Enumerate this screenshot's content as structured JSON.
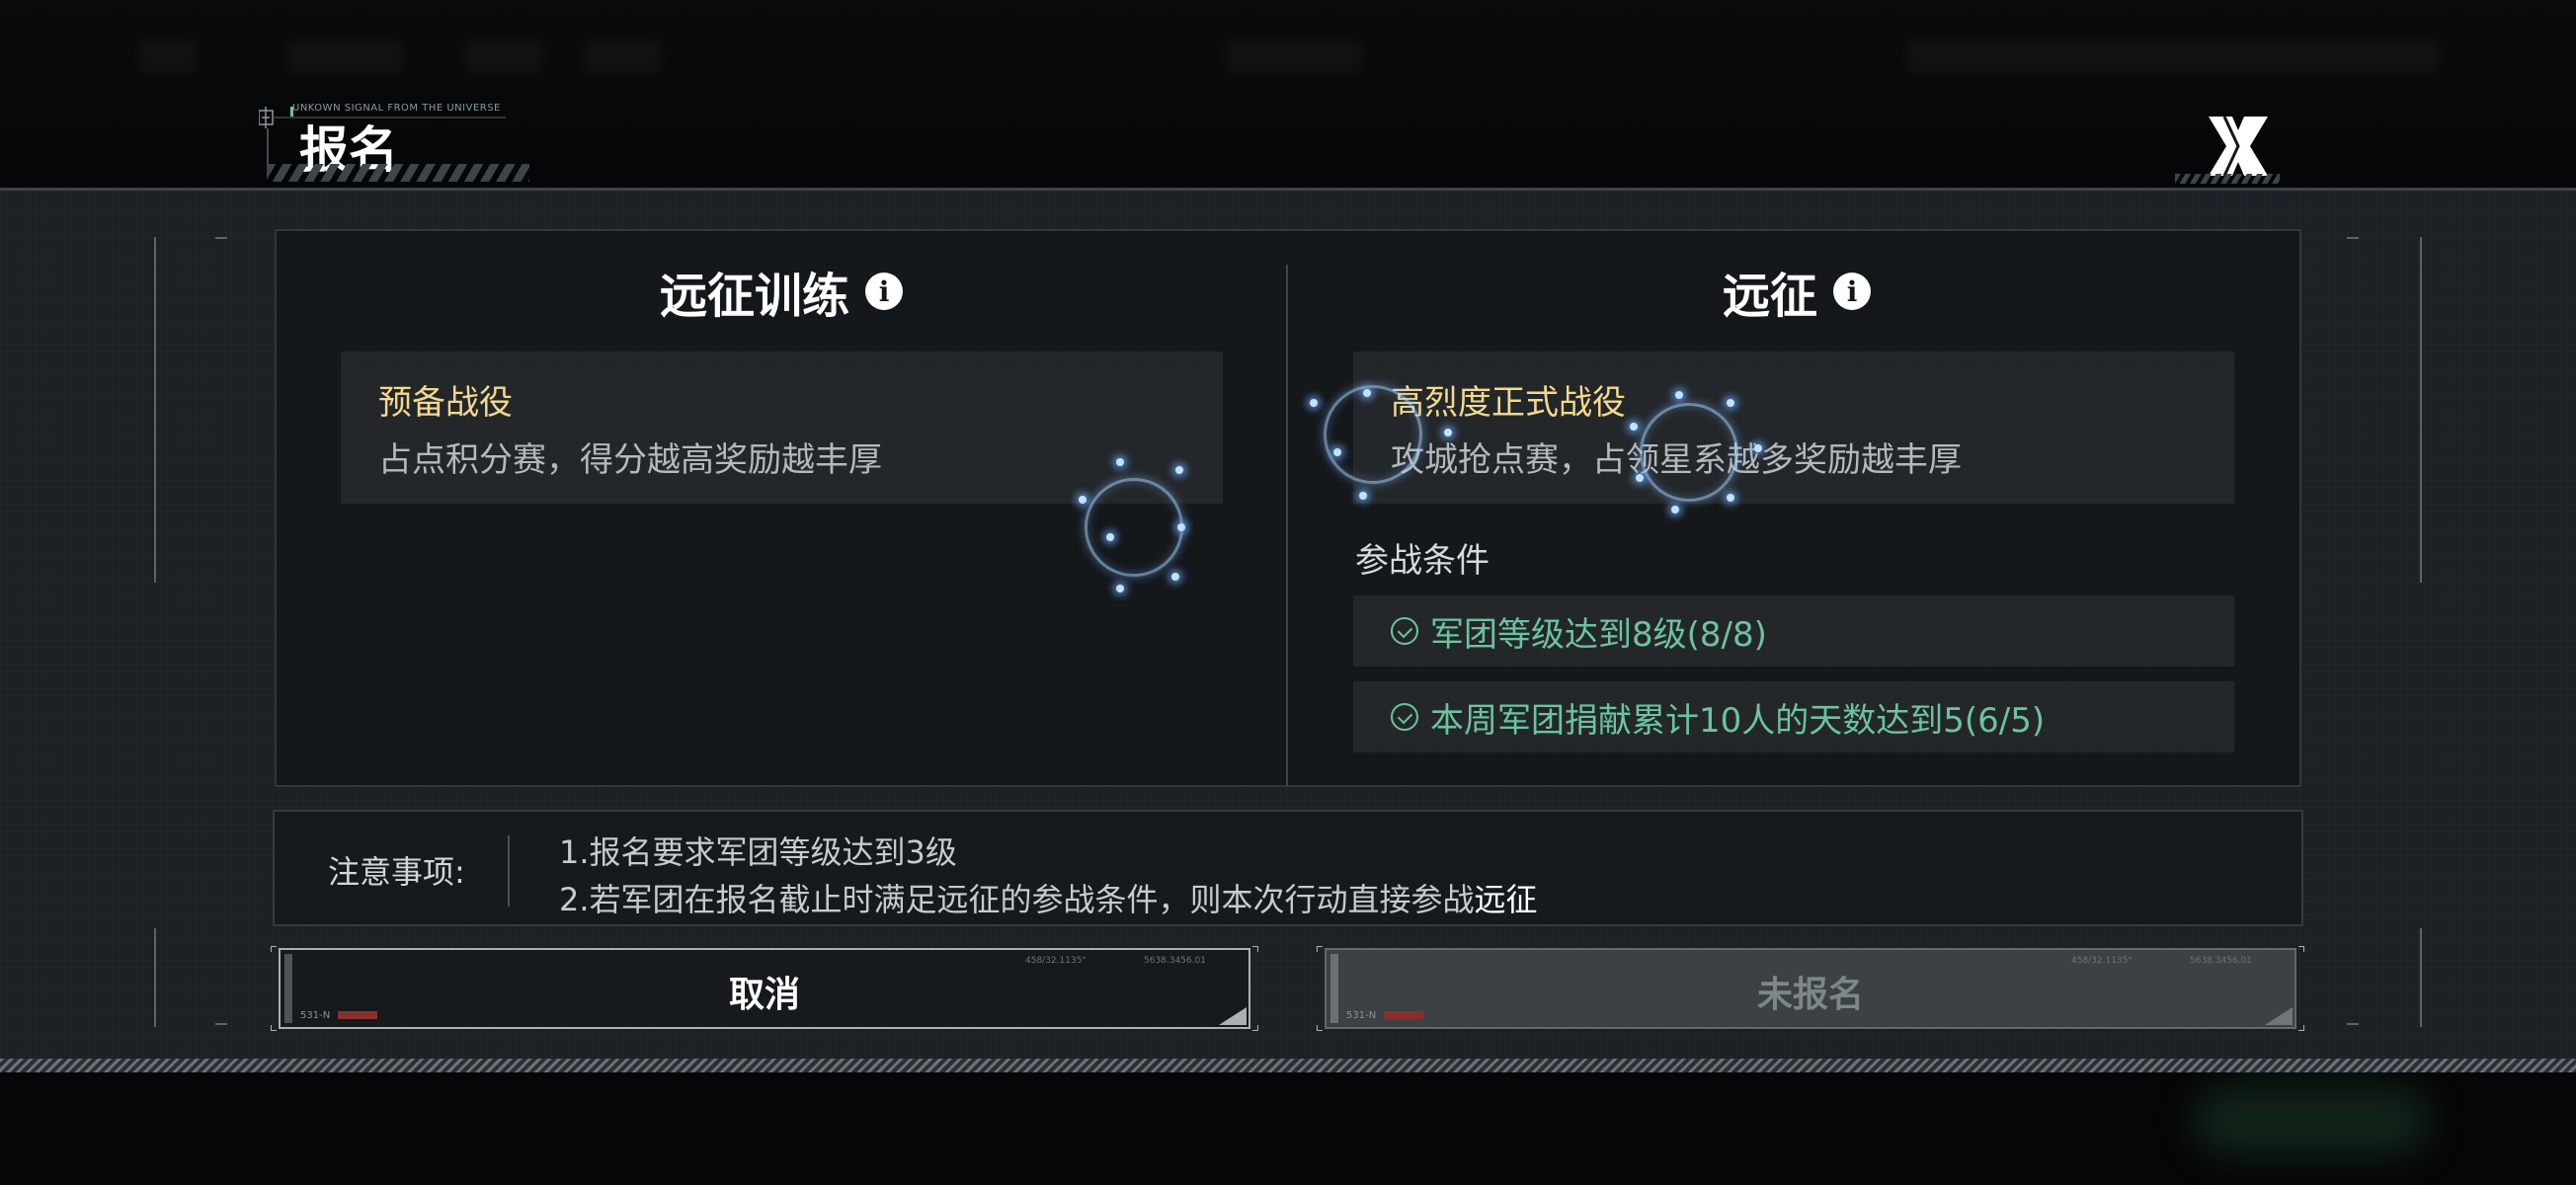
{
  "header": {
    "subtitle": "UNKOWN SIGNAL FROM THE UNIVERSE",
    "title": "报名",
    "close_icon": "close-x-icon"
  },
  "training": {
    "title": "远征训练",
    "info_icon": "info-icon",
    "card": {
      "title": "预备战役",
      "desc": "占点积分赛，得分越高奖励越丰厚"
    }
  },
  "expedition": {
    "title": "远征",
    "info_icon": "info-icon",
    "card": {
      "title": "高烈度正式战役",
      "desc": "攻城抢点赛，占领星系越多奖励越丰厚"
    },
    "conditions_label": "参战条件",
    "conditions": [
      {
        "text": "军团等级达到8级(8/8)",
        "met": true
      },
      {
        "text": "本周军团捐献累计10人的天数达到5(6/5)",
        "met": true
      }
    ]
  },
  "notes": {
    "label": "注意事项:",
    "lines": [
      "1.报名要求军团等级达到3级",
      "2.若军团在报名截止时满足远征的参战条件，则本次行动直接参战"
    ],
    "highlight": "远征"
  },
  "buttons": {
    "cancel": "取消",
    "signup": "未报名",
    "tag": "531-N"
  },
  "colors": {
    "accent_yellow": "#f3d98e",
    "condition_green": "#6cc39f",
    "background_panel": "#1b2024"
  }
}
